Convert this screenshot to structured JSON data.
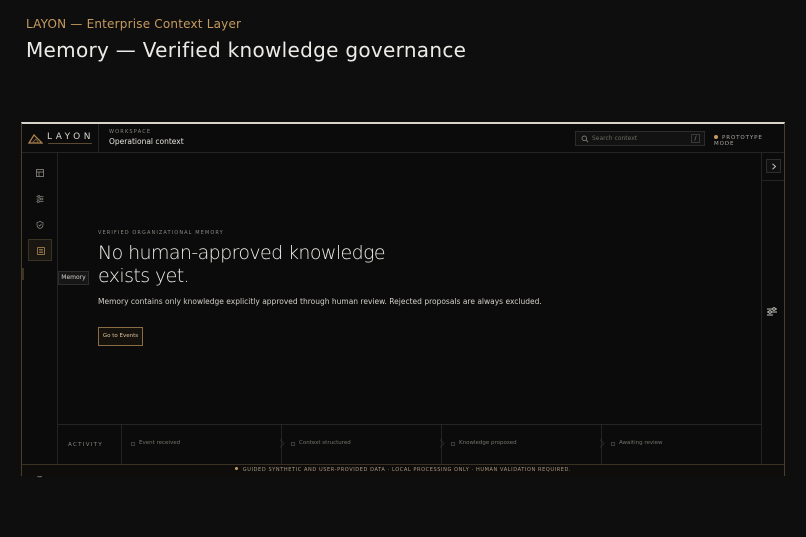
{
  "slide": {
    "kicker": "LAYON — Enterprise Context Layer",
    "headline": "Memory — Verified knowledge governance"
  },
  "topbar": {
    "logo_text": "LAYON",
    "workspace_label": "WORKSPACE",
    "workspace_name": "Operational context",
    "search_placeholder": "Search context",
    "search_shortcut": "/",
    "mode_label": "PROTOTYPE MODE"
  },
  "rail": {
    "items": [
      {
        "icon": "layout-icon",
        "label": "Overview"
      },
      {
        "icon": "sliders-icon",
        "label": "Context"
      },
      {
        "icon": "shield-check-icon",
        "label": "Governance"
      },
      {
        "icon": "memory-icon",
        "label": "Memory",
        "active": true
      }
    ],
    "tooltip": "Memory",
    "reset_icon": "reset-icon"
  },
  "memory": {
    "kicker": "VERIFIED ORGANIZATIONAL MEMORY",
    "title": "No human-approved knowledge exists yet.",
    "description": "Memory contains only knowledge explicitly approved through human review. Rejected proposals are always excluded.",
    "button_label": "Go to Events"
  },
  "activity": {
    "label": "ACTIVITY",
    "steps": [
      "Event received",
      "Context structured",
      "Knowledge proposed",
      "Awaiting review"
    ]
  },
  "footer": {
    "text": "GUIDED SYNTHETIC AND USER-PROVIDED DATA · LOCAL PROCESSING ONLY · HUMAN VALIDATION REQUIRED."
  },
  "colors": {
    "accent": "#c49a5e",
    "background": "#0b0b0b",
    "border": "#242424"
  }
}
